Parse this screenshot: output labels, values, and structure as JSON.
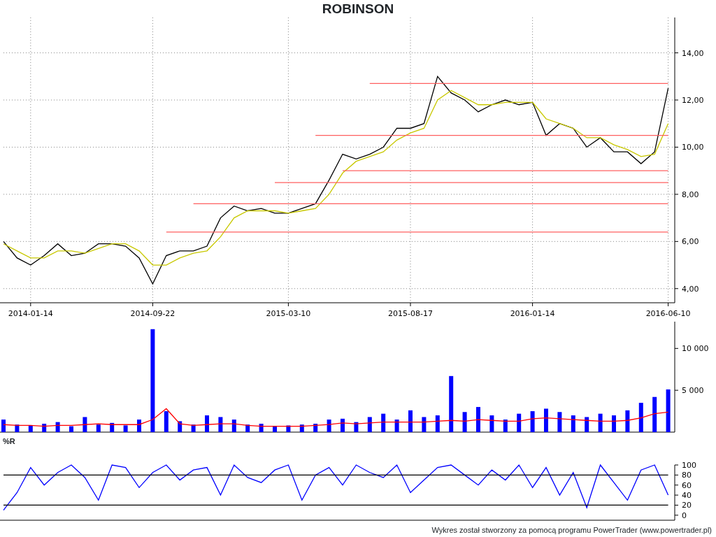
{
  "title": "ROBINSON",
  "price_chart": {
    "chart_data": {
      "type": "line",
      "categories": [
        null,
        null,
        "2014-01-14",
        null,
        null,
        null,
        null,
        null,
        null,
        null,
        null,
        "2014-09-22",
        null,
        null,
        null,
        null,
        null,
        null,
        null,
        null,
        null,
        "2015-03-10",
        null,
        null,
        null,
        null,
        null,
        null,
        null,
        null,
        "2015-08-17",
        null,
        null,
        null,
        null,
        null,
        null,
        null,
        null,
        "2016-01-14",
        null,
        null,
        null,
        null,
        null,
        null,
        null,
        null,
        null,
        "2016-06-10"
      ],
      "series": [
        {
          "color": "#000000",
          "values": [
            6.0,
            5.3,
            5.0,
            5.4,
            5.9,
            5.4,
            5.5,
            5.9,
            5.9,
            5.8,
            5.3,
            4.2,
            5.4,
            5.6,
            5.6,
            5.8,
            7.0,
            7.5,
            7.3,
            7.4,
            7.2,
            7.2,
            7.4,
            7.6,
            8.6,
            9.7,
            9.5,
            9.7,
            10.0,
            10.8,
            10.8,
            11.0,
            13.0,
            12.3,
            12.0,
            11.5,
            11.8,
            12.0,
            11.8,
            11.9,
            10.5,
            11.0,
            10.8,
            10.0,
            10.4,
            9.8,
            9.8,
            9.3,
            9.8,
            12.5
          ]
        },
        {
          "color": "#c8c800",
          "values": [
            5.9,
            5.6,
            5.3,
            5.3,
            5.6,
            5.6,
            5.5,
            5.7,
            5.9,
            5.9,
            5.6,
            5.0,
            5.0,
            5.3,
            5.5,
            5.6,
            6.2,
            7.0,
            7.3,
            7.3,
            7.3,
            7.2,
            7.3,
            7.4,
            8.0,
            8.9,
            9.4,
            9.6,
            9.8,
            10.3,
            10.6,
            10.8,
            12.0,
            12.4,
            12.1,
            11.8,
            11.8,
            11.9,
            11.9,
            11.9,
            11.2,
            11.0,
            10.8,
            10.4,
            10.4,
            10.1,
            9.9,
            9.6,
            9.7,
            11.0
          ]
        },
        {
          "color": "#ff6060",
          "values": [
            null,
            null,
            null,
            null,
            null,
            null,
            null,
            null,
            null,
            null,
            null,
            null,
            6.4,
            6.4,
            6.4,
            6.4,
            6.4,
            6.4,
            6.4,
            6.4,
            6.4,
            6.4,
            6.4,
            6.4,
            6.4,
            6.4,
            6.4,
            6.4,
            6.4,
            6.4,
            6.4,
            6.4,
            6.4,
            6.4,
            6.4,
            6.4,
            6.4,
            6.4,
            6.4,
            6.4,
            6.4,
            6.4,
            6.4,
            6.4,
            6.4,
            6.4,
            6.4,
            6.4,
            6.4,
            6.4
          ]
        },
        {
          "color": "#ff6060",
          "values": [
            null,
            null,
            null,
            null,
            null,
            null,
            null,
            null,
            null,
            null,
            null,
            null,
            null,
            null,
            7.6,
            7.6,
            7.6,
            7.6,
            7.6,
            7.6,
            7.6,
            7.6,
            7.6,
            7.6,
            7.6,
            7.6,
            7.6,
            7.6,
            7.6,
            7.6,
            7.6,
            7.6,
            7.6,
            7.6,
            7.6,
            7.6,
            7.6,
            7.6,
            7.6,
            7.6,
            7.6,
            7.6,
            7.6,
            7.6,
            7.6,
            7.6,
            7.6,
            7.6,
            7.6,
            7.6
          ]
        },
        {
          "color": "#ff6060",
          "values": [
            null,
            null,
            null,
            null,
            null,
            null,
            null,
            null,
            null,
            null,
            null,
            null,
            null,
            null,
            null,
            null,
            null,
            null,
            null,
            null,
            8.5,
            8.5,
            8.5,
            8.5,
            8.5,
            8.5,
            8.5,
            8.5,
            8.5,
            8.5,
            8.5,
            8.5,
            8.5,
            8.5,
            8.5,
            8.5,
            8.5,
            8.5,
            8.5,
            8.5,
            8.5,
            8.5,
            8.5,
            8.5,
            8.5,
            8.5,
            8.5,
            8.5,
            8.5,
            8.5
          ]
        },
        {
          "color": "#ff6060",
          "values": [
            null,
            null,
            null,
            null,
            null,
            null,
            null,
            null,
            null,
            null,
            null,
            null,
            null,
            null,
            null,
            null,
            null,
            null,
            null,
            null,
            null,
            null,
            null,
            null,
            null,
            9.0,
            9.0,
            9.0,
            9.0,
            9.0,
            9.0,
            9.0,
            9.0,
            9.0,
            9.0,
            9.0,
            9.0,
            9.0,
            9.0,
            9.0,
            9.0,
            9.0,
            9.0,
            9.0,
            9.0,
            9.0,
            9.0,
            9.0,
            9.0,
            9.0
          ]
        },
        {
          "color": "#ff6060",
          "values": [
            null,
            null,
            null,
            null,
            null,
            null,
            null,
            null,
            null,
            null,
            null,
            null,
            null,
            null,
            null,
            null,
            null,
            null,
            null,
            null,
            null,
            null,
            null,
            10.5,
            10.5,
            10.5,
            10.5,
            10.5,
            10.5,
            10.5,
            10.5,
            10.5,
            10.5,
            10.5,
            10.5,
            10.5,
            10.5,
            10.5,
            10.5,
            10.5,
            10.5,
            10.5,
            10.5,
            10.5,
            10.5,
            10.5,
            10.5,
            10.5,
            10.5,
            10.5
          ]
        },
        {
          "color": "#ff6060",
          "values": [
            null,
            null,
            null,
            null,
            null,
            null,
            null,
            null,
            null,
            null,
            null,
            null,
            null,
            null,
            null,
            null,
            null,
            null,
            null,
            null,
            null,
            null,
            null,
            null,
            null,
            null,
            null,
            12.7,
            12.7,
            12.7,
            12.7,
            12.7,
            12.7,
            12.7,
            12.7,
            12.7,
            12.7,
            12.7,
            12.7,
            12.7,
            12.7,
            12.7,
            12.7,
            12.7,
            12.7,
            12.7,
            12.7,
            12.7,
            12.7,
            12.7
          ]
        }
      ],
      "ylim": [
        3.4,
        15.5
      ],
      "grid": true,
      "yticks": [
        {
          "value": 4,
          "label": "4,00"
        },
        {
          "value": 6,
          "label": "6,00"
        },
        {
          "value": 8,
          "label": "8,00"
        },
        {
          "value": 10,
          "label": "10,00"
        },
        {
          "value": 12,
          "label": "12,00"
        },
        {
          "value": 14,
          "label": "14,00"
        }
      ]
    }
  },
  "volume_chart": {
    "chart_data": {
      "type": "bar",
      "categories": [
        null,
        null,
        null,
        null,
        null,
        null,
        null,
        null,
        null,
        null,
        null,
        null,
        null,
        null,
        null,
        null,
        null,
        null,
        null,
        null,
        null,
        null,
        null,
        null,
        null,
        null,
        null,
        null,
        null,
        null,
        null,
        null,
        null,
        null,
        null,
        null,
        null,
        null,
        null,
        null,
        null,
        null,
        null,
        null,
        null,
        null,
        null,
        null,
        null,
        null
      ],
      "series": [
        {
          "color": "#0000ff",
          "values": [
            1500,
            900,
            800,
            1000,
            1200,
            700,
            1800,
            900,
            1100,
            800,
            1500,
            12300,
            2500,
            1300,
            900,
            2000,
            1800,
            1500,
            900,
            1000,
            700,
            800,
            900,
            1000,
            1500,
            1600,
            1200,
            1800,
            2200,
            1500,
            2600,
            1800,
            2000,
            6700,
            2400,
            3000,
            2000,
            1500,
            2200,
            2500,
            2800,
            2400,
            2000,
            1800,
            2200,
            2000,
            2600,
            3500,
            4200,
            5100
          ]
        },
        {
          "color": "#ff0000",
          "type": "line",
          "values": [
            900,
            800,
            800,
            700,
            800,
            800,
            900,
            1000,
            900,
            900,
            900,
            1500,
            2800,
            1000,
            800,
            900,
            1000,
            1000,
            800,
            700,
            700,
            700,
            700,
            800,
            900,
            1100,
            1000,
            1100,
            1200,
            1200,
            1200,
            1200,
            1300,
            1400,
            1300,
            1500,
            1400,
            1300,
            1300,
            1600,
            1700,
            1600,
            1500,
            1400,
            1300,
            1300,
            1400,
            1700,
            2200,
            2400
          ]
        }
      ],
      "ylim": [
        0,
        13200
      ],
      "yticks": [
        {
          "value": 5000,
          "label": "5 000"
        },
        {
          "value": 10000,
          "label": "10 000"
        }
      ]
    }
  },
  "williams_chart": {
    "label": "%R",
    "chart_data": {
      "type": "line",
      "categories": [
        null,
        null,
        null,
        null,
        null,
        null,
        null,
        null,
        null,
        null,
        null,
        null,
        null,
        null,
        null,
        null,
        null,
        null,
        null,
        null,
        null,
        null,
        null,
        null,
        null,
        null,
        null,
        null,
        null,
        null,
        null,
        null,
        null,
        null,
        null,
        null,
        null,
        null,
        null,
        null,
        null,
        null,
        null,
        null,
        null,
        null,
        null,
        null,
        null,
        null
      ],
      "series": [
        {
          "color": "#0000ff",
          "values": [
            10,
            45,
            95,
            60,
            85,
            100,
            75,
            30,
            100,
            95,
            55,
            85,
            100,
            70,
            90,
            95,
            40,
            100,
            75,
            65,
            90,
            100,
            30,
            80,
            95,
            60,
            100,
            85,
            75,
            100,
            45,
            70,
            95,
            100,
            80,
            60,
            90,
            70,
            100,
            55,
            95,
            40,
            85,
            15,
            100,
            65,
            30,
            90,
            100,
            40
          ]
        },
        {
          "color": "#000000",
          "values": [
            80,
            80,
            80,
            80,
            80,
            80,
            80,
            80,
            80,
            80,
            80,
            80,
            80,
            80,
            80,
            80,
            80,
            80,
            80,
            80,
            80,
            80,
            80,
            80,
            80,
            80,
            80,
            80,
            80,
            80,
            80,
            80,
            80,
            80,
            80,
            80,
            80,
            80,
            80,
            80,
            80,
            80,
            80,
            80,
            80,
            80,
            80,
            80,
            80,
            80
          ]
        },
        {
          "color": "#000000",
          "values": [
            20,
            20,
            20,
            20,
            20,
            20,
            20,
            20,
            20,
            20,
            20,
            20,
            20,
            20,
            20,
            20,
            20,
            20,
            20,
            20,
            20,
            20,
            20,
            20,
            20,
            20,
            20,
            20,
            20,
            20,
            20,
            20,
            20,
            20,
            20,
            20,
            20,
            20,
            20,
            20,
            20,
            20,
            20,
            20,
            20,
            20,
            20,
            20,
            20,
            20
          ]
        }
      ],
      "ylim": [
        -10,
        100
      ],
      "yticks": [
        0,
        20,
        40,
        60,
        80,
        100
      ]
    }
  },
  "footer": "Wykres został stworzony za pomocą programu PowerTrader (www.powertrader.pl)"
}
